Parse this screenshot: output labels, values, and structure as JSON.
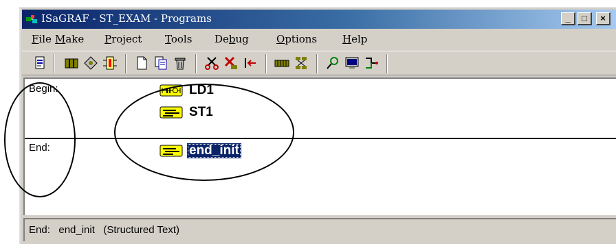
{
  "window": {
    "title": "ISaGRAF - ST_EXAM - Programs",
    "controls": {
      "minimize": "_",
      "maximize": "□",
      "close": "×"
    }
  },
  "menu": [
    {
      "name": "menu-file",
      "pre": "",
      "key": "F",
      "post": "ile"
    },
    {
      "name": "menu-make",
      "pre": "",
      "key": "M",
      "post": "ake"
    },
    {
      "name": "menu-project",
      "pre": "",
      "key": "P",
      "post": "roject"
    },
    {
      "name": "menu-tools",
      "pre": "",
      "key": "T",
      "post": "ools"
    },
    {
      "name": "menu-debug",
      "pre": "De",
      "key": "b",
      "post": "ug"
    },
    {
      "name": "menu-options",
      "pre": "",
      "key": "O",
      "post": "ptions"
    },
    {
      "name": "menu-help",
      "pre": "",
      "key": "H",
      "post": "elp"
    }
  ],
  "toolbar": [
    "open-program-icon",
    "dictionary-icon",
    "hierarchy-icon",
    "io-connection-icon",
    "new-program-icon",
    "copy-program-icon",
    "delete-program-icon",
    "cut-icon",
    "link-icon",
    "move-icon",
    "io-board-icon",
    "network-icon",
    "debug-icon",
    "simulate-icon",
    "compare-icon"
  ],
  "sections": {
    "begin": "Begin:",
    "end": "End:"
  },
  "programs": [
    {
      "name": "LD1",
      "icon": "ladder-diagram-icon",
      "selected": false
    },
    {
      "name": "ST1",
      "icon": "structured-text-icon",
      "selected": false
    },
    {
      "name": "end_init",
      "icon": "structured-text-icon",
      "selected": true
    }
  ],
  "status": {
    "text": "End:   end_init   (Structured Text)"
  }
}
